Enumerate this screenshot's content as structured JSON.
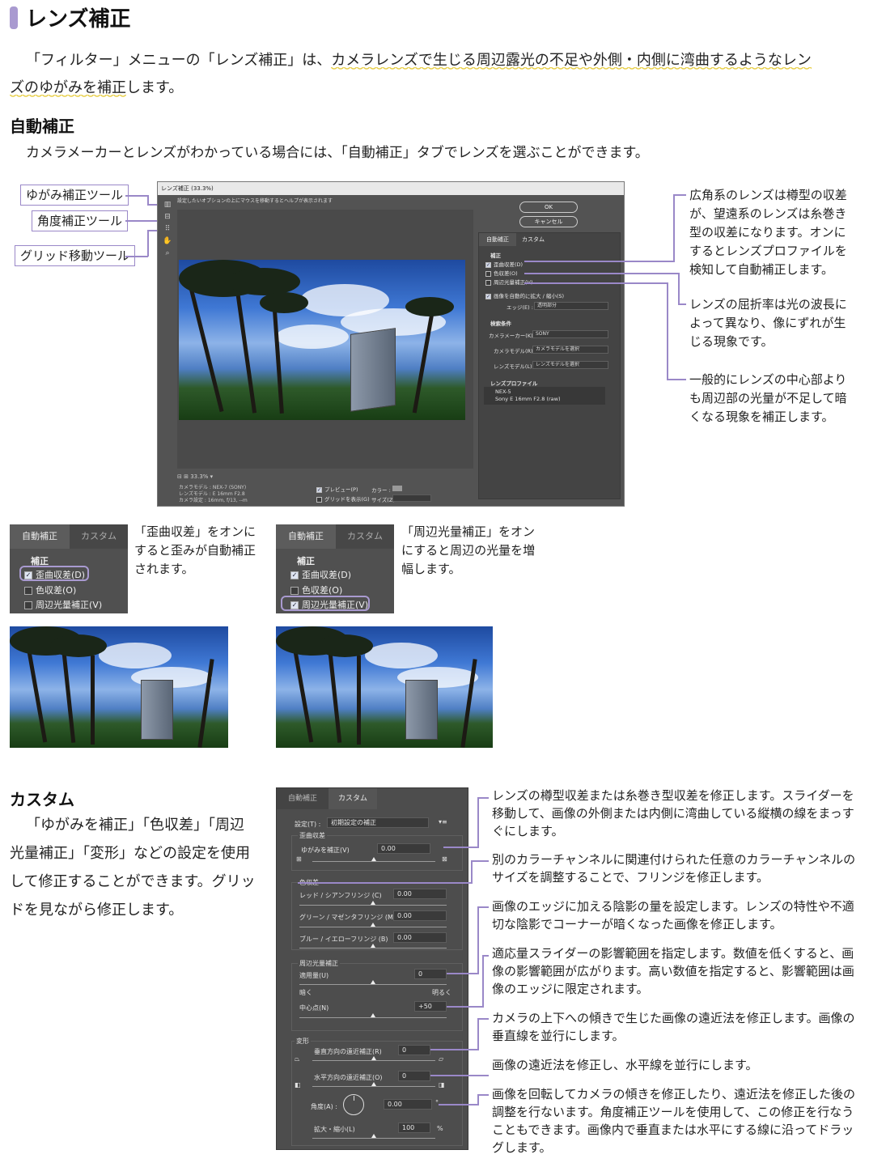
{
  "title": "レンズ補正",
  "intro": {
    "prefix": "「フィルター」メニューの「レンズ補正」は、",
    "highlight1": "カメラレンズで生じる周辺露光の不足や外側・内側に湾曲するようなレン",
    "highlight2": "ズのゆがみを補正",
    "suffix": "します。"
  },
  "auto_section": {
    "heading": "自動補正",
    "body": "カメラメーカーとレンズがわかっている場合には、「自動補正」タブでレンズを選ぶことができます。"
  },
  "tool_labels": [
    "ゆがみ補正ツール",
    "角度補正ツール",
    "グリッド移動ツール"
  ],
  "dialog": {
    "title": "レンズ補正 (33.3%)",
    "hint": "設定したいオプションの上にマウスを移動するとヘルプが表示されます",
    "ok": "OK",
    "cancel": "キャンセル",
    "zoom": "33.3%",
    "cam_info": "カメラモデル : NEX-7 (SONY)\nレンズモデル : E 16mm F2.8\nカメラ設定 : 16mm, f/13, --m",
    "preview": "プレビュー(P)",
    "show_grid": "グリッドを表示(G)",
    "color_label": "カラー :",
    "size_label": "サイズ(Z) :",
    "tabs": [
      "自動補正",
      "カスタム"
    ],
    "correction_heading": "補正",
    "checks": [
      {
        "label": "歪曲収差(D)",
        "on": true
      },
      {
        "label": "色収差(O)",
        "on": false
      },
      {
        "label": "周辺光量補正(V)",
        "on": false
      }
    ],
    "auto_scale": "画像を自動的に拡大 / 縮小(S)",
    "edge_label": "エッジ(E) :",
    "edge_value": "透明部分",
    "search_heading": "検索条件",
    "maker_label": "カメラメーカー(K) :",
    "maker_value": "SONY",
    "model_label": "カメラモデル(R) :",
    "model_value": "カメラモデルを選択",
    "lens_label": "レンズモデル(L) :",
    "lens_value": "レンズモデルを選択",
    "profile_heading": "レンズプロファイル",
    "profile_line1": "NEX-5",
    "profile_line2": "Sony E 16mm F2.8 (raw)"
  },
  "right_notes": [
    "広角系のレンズは樽型の収差が、望遠系のレンズは糸巻き型の収差になります。オンにするとレンズプロファイルを検知して自動補正します。",
    "レンズの屈折率は光の波長によって異なり、像にずれが生じる現象です。",
    "一般的にレンズの中心部よりも周辺部の光量が不足して暗くなる現象を補正します。"
  ],
  "mini_panels": [
    {
      "tabs": [
        "自動補正",
        "カスタム"
      ],
      "heading": "補正",
      "items": [
        "歪曲収差(D)",
        "色収差(O)",
        "周辺光量補正(V)"
      ],
      "checked": [
        true,
        false,
        false
      ],
      "note": "「歪曲収差」をオンにすると歪みが自動補正されます。"
    },
    {
      "tabs": [
        "自動補正",
        "カスタム"
      ],
      "heading": "補正",
      "items": [
        "歪曲収差(D)",
        "色収差(O)",
        "周辺光量補正(V)"
      ],
      "checked": [
        true,
        false,
        true
      ],
      "note": "「周辺光量補正」をオンにすると周辺の光量を増幅します。"
    }
  ],
  "custom_section": {
    "heading": "カスタム",
    "body": "「ゆがみを補正」「色収差」「周辺光量補正」「変形」などの設定を使用して修正することができます。グリッドを見ながら修正します。"
  },
  "custom_panel": {
    "tabs": [
      "自動補正",
      "カスタム"
    ],
    "setting_label": "設定(T) :",
    "setting_value": "初期設定の補正",
    "distortion_group": "歪曲収差",
    "distortion_label": "ゆがみを補正(V)",
    "distortion_value": "0.00",
    "chroma_group": "色収差",
    "chroma_rows": [
      {
        "label": "レッド / シアンフリンジ (C)",
        "value": "0.00"
      },
      {
        "label": "グリーン / マゼンタフリンジ (M)",
        "value": "0.00"
      },
      {
        "label": "ブルー / イエローフリンジ (B)",
        "value": "0.00"
      }
    ],
    "vignette_group": "周辺光量補正",
    "amount_label": "適用量(U)",
    "amount_value": "0",
    "darker": "暗く",
    "brighter": "明るく",
    "midpoint_label": "中心点(N)",
    "midpoint_value": "+50",
    "transform_group": "変形",
    "vertical_label": "垂直方向の遠近補正(R)",
    "vertical_value": "0",
    "horizontal_label": "水平方向の遠近補正(O)",
    "horizontal_value": "0",
    "angle_label": "角度(A) :",
    "angle_value": "0.00",
    "degree": "°",
    "scale_label": "拡大・縮小(L)",
    "scale_value": "100",
    "percent": "%"
  },
  "custom_notes": [
    "レンズの樽型収差または糸巻き型収差を修正します。スライダーを移動して、画像の外側または内側に湾曲している縦横の線をまっすぐにします。",
    "別のカラーチャンネルに関連付けられた任意のカラーチャンネルのサイズを調整することで、フリンジを修正します。",
    "画像のエッジに加える陰影の量を設定します。レンズの特性や不適切な陰影でコーナーが暗くなった画像を修正します。",
    "適応量スライダーの影響範囲を指定します。数値を低くすると、画像の影響範囲が広がります。高い数値を指定すると、影響範囲は画像のエッジに限定されます。",
    "カメラの上下への傾きで生じた画像の遠近法を修正します。画像の垂直線を並行にします。",
    "画像の遠近法を修正し、水平線を並行にします。",
    "画像を回転してカメラの傾きを修正したり、遠近法を修正した後の調整を行ないます。角度補正ツールを使用して、この修正を行なうこともできます。画像内で垂直または水平にする線に沿ってドラッグします。"
  ],
  "colors": {
    "accent": "#9a88c8",
    "wave": "#e8cf4a",
    "panel": "#535353"
  }
}
